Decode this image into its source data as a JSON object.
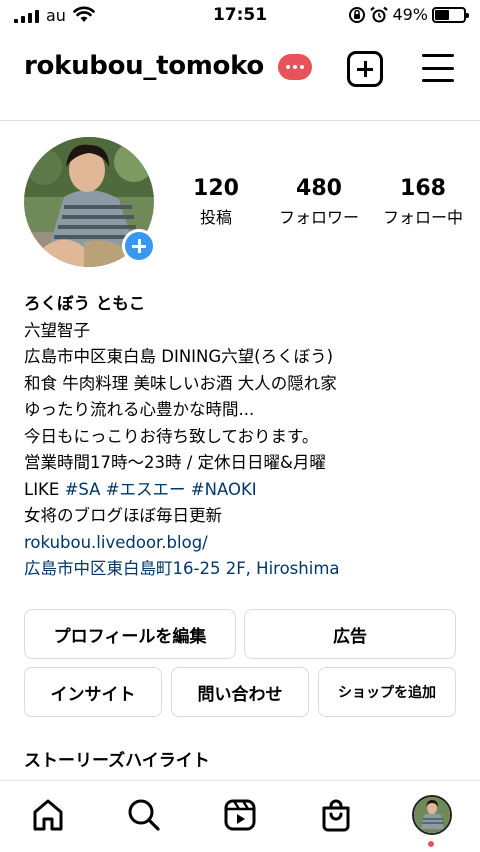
{
  "status_bar": {
    "carrier": "au",
    "time": "17:51",
    "battery_percent": "49%",
    "battery_level": 0.49
  },
  "header": {
    "username": "rokubou_tomoko"
  },
  "profile": {
    "stats": [
      {
        "value": "120",
        "label": "投稿"
      },
      {
        "value": "480",
        "label": "フォロワー"
      },
      {
        "value": "168",
        "label": "フォロー中"
      }
    ],
    "display_name": "ろくぼう ともこ",
    "bio_lines": [
      "六望智子",
      "広島市中区東白島  DINING六望(ろくぼう)",
      "和食 牛肉料理  美味しいお酒 大人の隠れ家",
      "ゆったり流れる心豊かな時間...",
      "今日もにっこりお待ち致しております。",
      "営業時間17時〜23時 / 定休日日曜&月曜"
    ],
    "like_prefix": "LIKE ",
    "hashtags": [
      "#SA",
      "#エスエー",
      "#NAOKI"
    ],
    "bio_after": "女将のブログほぼ毎日更新",
    "website": "rokubou.livedoor.blog/",
    "address": "広島市中区東白島町16-25 2F, Hiroshima"
  },
  "buttons": {
    "edit_profile": "プロフィールを編集",
    "ads": "広告",
    "insights": "インサイト",
    "contact": "問い合わせ",
    "add_shop": "ショップを追加"
  },
  "highlights_title": "ストーリーズハイライト",
  "icons": {
    "nav": [
      "home-icon",
      "search-icon",
      "reels-icon",
      "shop-icon",
      "profile-avatar"
    ],
    "header": [
      "notification-badge",
      "new-post-icon",
      "menu-icon"
    ]
  },
  "colors": {
    "link": "#00376b",
    "accent_blue": "#3897f0",
    "badge_red": "#e8525a",
    "border": "#dbdbdb"
  }
}
